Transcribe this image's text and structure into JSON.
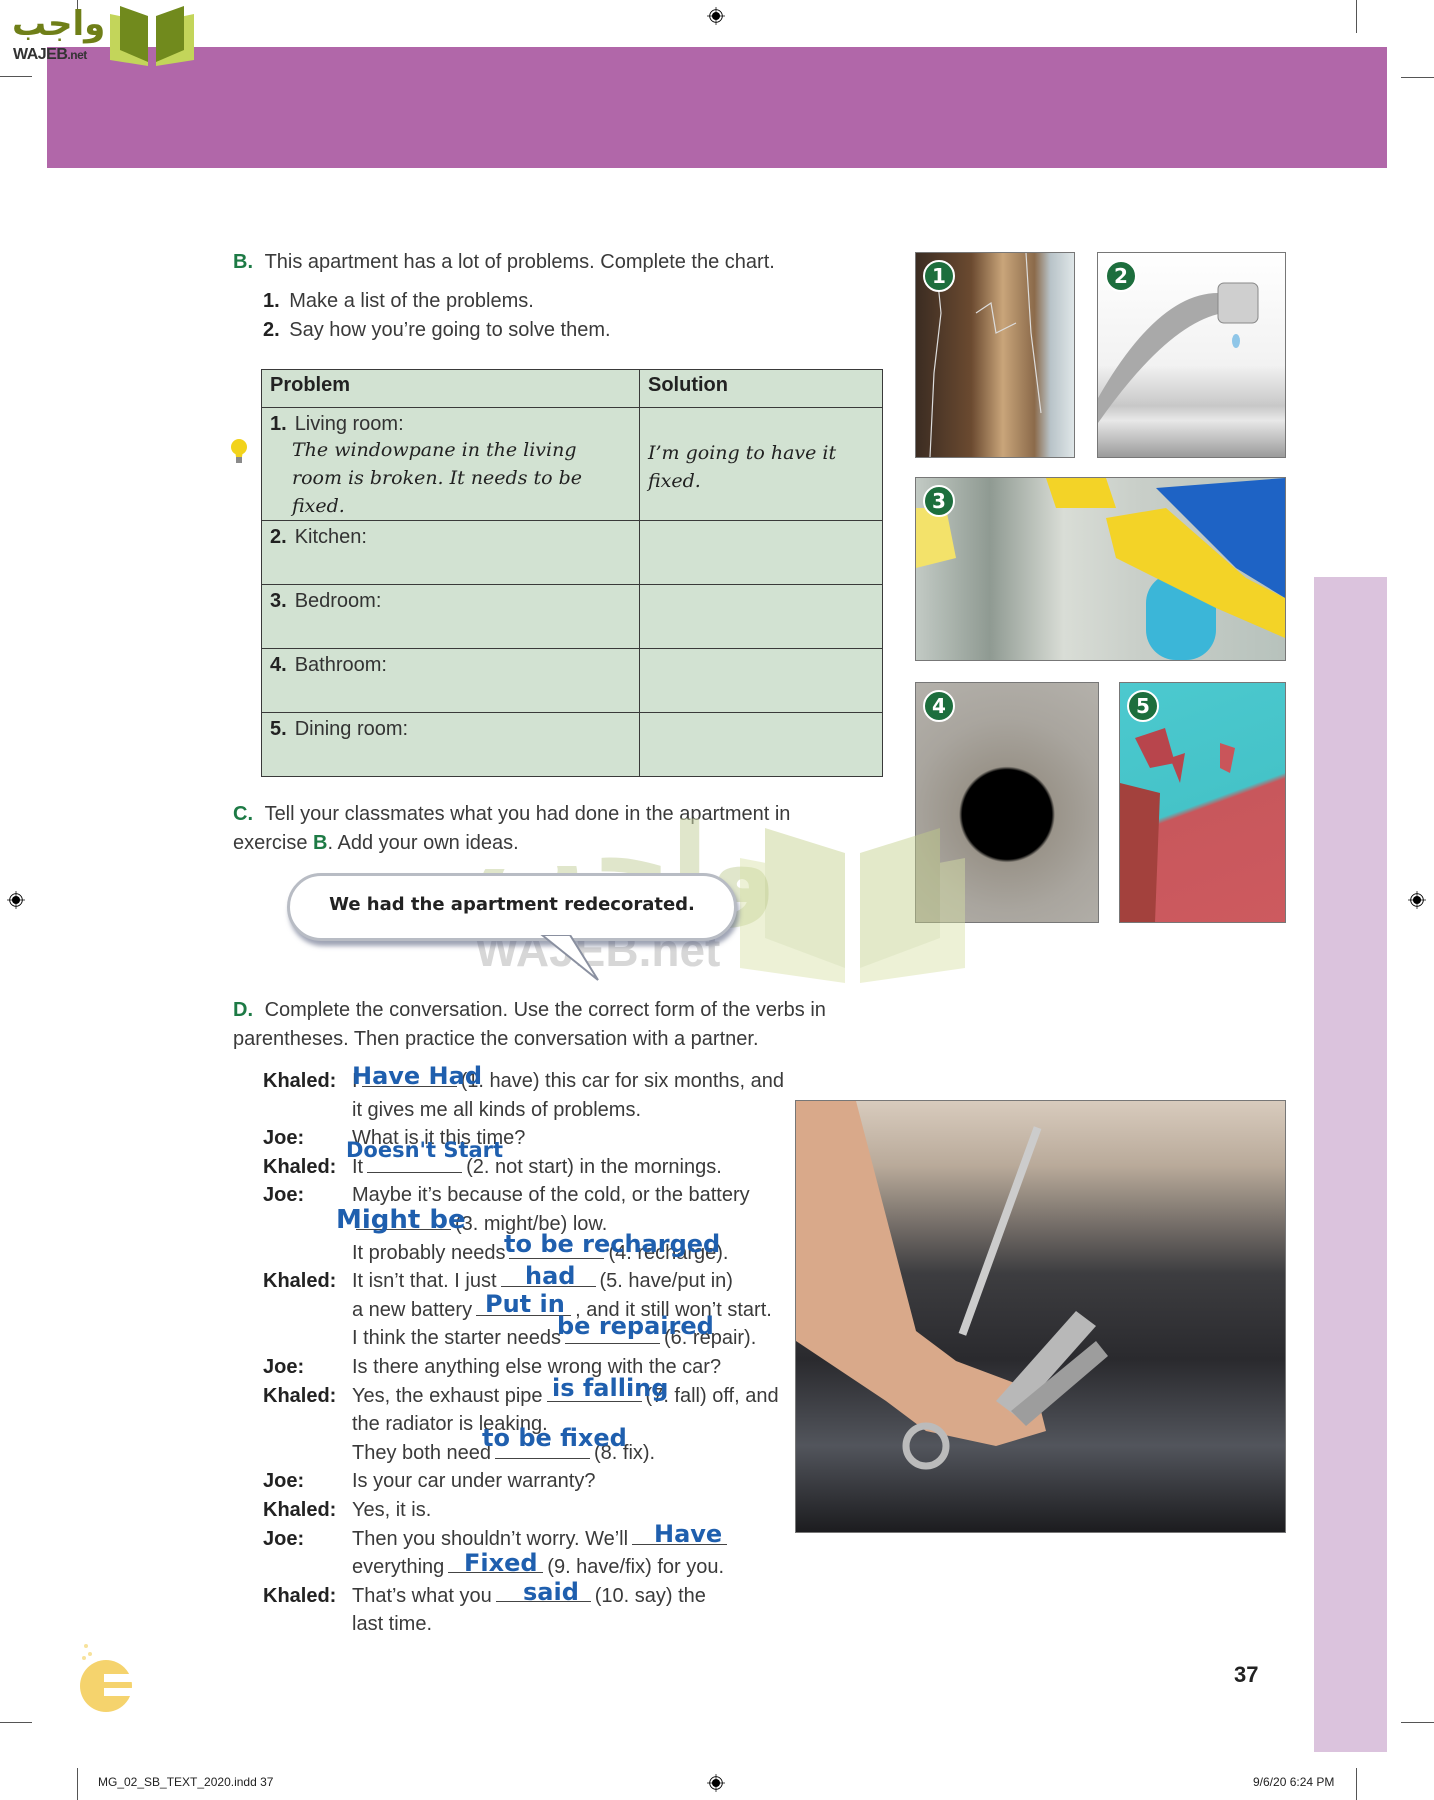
{
  "header": {
    "logo_arabic": "واجب",
    "logo_latin": "WAJEB",
    "logo_suffix": ".net",
    "banner_color": "#b167a9"
  },
  "section_b": {
    "letter": "B.",
    "instruction": "This apartment has a lot of problems. Complete the chart.",
    "steps": [
      {
        "num": "1.",
        "text": "Make a list of the problems."
      },
      {
        "num": "2.",
        "text": "Say how you’re going to solve them."
      }
    ],
    "table": {
      "headers": [
        "Problem",
        "Solution"
      ],
      "rows": [
        {
          "num": "1.",
          "room": "Living room:",
          "problem": "The windowpane in the living room is broken. It needs to be fixed.",
          "solution": "I’m going to have it fixed."
        },
        {
          "num": "2.",
          "room": "Kitchen:",
          "problem": "",
          "solution": ""
        },
        {
          "num": "3.",
          "room": "Bedroom:",
          "problem": "",
          "solution": ""
        },
        {
          "num": "4.",
          "room": "Bathroom:",
          "problem": "",
          "solution": ""
        },
        {
          "num": "5.",
          "room": "Dining room:",
          "problem": "",
          "solution": ""
        }
      ]
    },
    "tip_icon": "lightbulb-icon"
  },
  "photos": [
    {
      "num": "1",
      "subject": "cracked windowpane"
    },
    {
      "num": "2",
      "subject": "dripping faucet"
    },
    {
      "num": "3",
      "subject": "cleaning a window"
    },
    {
      "num": "4",
      "subject": "hole in wall"
    },
    {
      "num": "5",
      "subject": "peeling paint"
    }
  ],
  "section_c": {
    "letter": "C.",
    "instruction_part1": "Tell your classmates what you had done in the apartment in exercise ",
    "instruction_ref": "B",
    "instruction_part2": ". Add your own ideas.",
    "bubble": "We had the apartment redecorated."
  },
  "watermark": {
    "arabic": "واجب",
    "latin": "WAJEB.net"
  },
  "section_d": {
    "letter": "D.",
    "instruction": "Complete the conversation. Use the correct form of the verbs in parentheses. Then practice the conversation with a partner.",
    "lines": [
      {
        "speaker": "Khaled:",
        "pre": "I",
        "blank": true,
        "post": "(1. have) this car for six months, and"
      },
      {
        "speaker": "",
        "pre": "it gives me all kinds of problems.",
        "blank": false,
        "post": ""
      },
      {
        "speaker": "Joe:",
        "pre": "What is it this time?",
        "blank": false,
        "post": ""
      },
      {
        "speaker": "Khaled:",
        "pre": "It",
        "blank": true,
        "post": "(2. not start) in the mornings."
      },
      {
        "speaker": "Joe:",
        "pre": "Maybe it’s because of the cold, or the battery",
        "blank": false,
        "post": ""
      },
      {
        "speaker": "",
        "pre": "",
        "blank": true,
        "post": "(3. might/be) low."
      },
      {
        "speaker": "",
        "pre": "It probably needs",
        "blank": true,
        "post": "(4. recharge)."
      },
      {
        "speaker": "Khaled:",
        "pre": "It isn’t that. I just",
        "blank": true,
        "post": "(5. have/put in)"
      },
      {
        "speaker": "",
        "pre": "a new battery",
        "blank": true,
        "post": ", and it still won’t start."
      },
      {
        "speaker": "",
        "pre": "I think the starter needs",
        "blank": true,
        "post": "(6. repair)."
      },
      {
        "speaker": "Joe:",
        "pre": "Is there anything else wrong with the car?",
        "blank": false,
        "post": ""
      },
      {
        "speaker": "Khaled:",
        "pre": "Yes, the exhaust pipe",
        "blank": true,
        "post": "(7. fall) off, and"
      },
      {
        "speaker": "",
        "pre": "the radiator is leaking.",
        "blank": false,
        "post": ""
      },
      {
        "speaker": "",
        "pre": "They both need",
        "blank": true,
        "post": "(8. fix)."
      },
      {
        "speaker": "Joe:",
        "pre": "Is your car under warranty?",
        "blank": false,
        "post": ""
      },
      {
        "speaker": "Khaled:",
        "pre": "Yes, it is.",
        "blank": false,
        "post": ""
      },
      {
        "speaker": "Joe:",
        "pre": "Then you shouldn’t worry. We’ll",
        "blank": true,
        "post": ""
      },
      {
        "speaker": "",
        "pre": "everything",
        "blank": true,
        "post": "(9. have/fix) for you."
      },
      {
        "speaker": "Khaled:",
        "pre": "That’s what you",
        "blank": true,
        "post": "(10. say) the"
      },
      {
        "speaker": "",
        "pre": "last time.",
        "blank": false,
        "post": ""
      }
    ],
    "answers": [
      "Have Had",
      "Doesn't Start",
      "Might be",
      "to be recharged",
      "had",
      "Put in",
      "be repaired",
      "is falling",
      "to be fixed",
      "Have",
      "Fixed",
      "said"
    ],
    "answer_color": "#1f5fae"
  },
  "footer": {
    "page_number": "37",
    "file_name": "MG_02_SB_TEXT_2020.indd   37",
    "timestamp": "9/6/20   6:24 PM"
  }
}
